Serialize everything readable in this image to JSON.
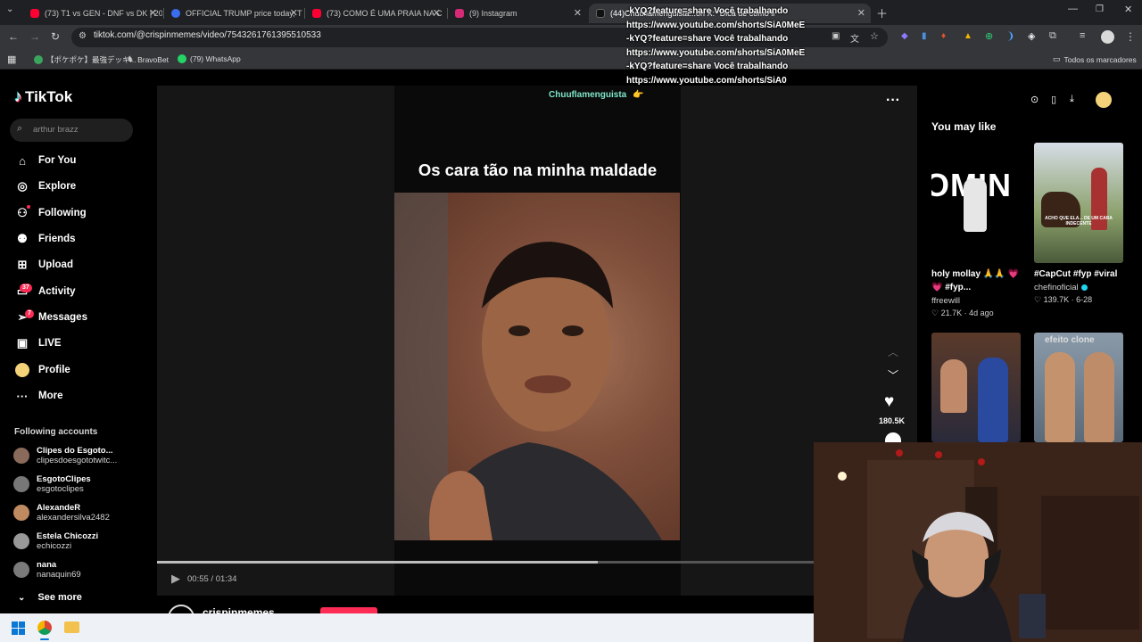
{
  "browser": {
    "tabs": [
      {
        "title": "(73) T1 vs GEN - DNF vs DK | 20",
        "favicon_color": "#ff0033",
        "active": false
      },
      {
        "title": "OFFICIAL TRUMP price today, T",
        "favicon_color": "#3a6df0",
        "active": false
      },
      {
        "title": "(73) COMO É UMA PRAIA NA C",
        "favicon_color": "#ff0033",
        "active": false
      },
      {
        "title": "(9) Instagram",
        "favicon_color": "#d62976",
        "active": false
      },
      {
        "title": "(44)Chuuflamenguista...on X: \"Dica de como li",
        "favicon_color": "#111111",
        "active": true
      }
    ],
    "url": "tiktok.com/@crispinmemes/video/7543261761395510533",
    "bookmarks": [
      {
        "label": "【ポケポケ】最強デッキ...",
        "icon": "globe-icon"
      },
      {
        "label": "BravoBet",
        "icon": "bravobet-icon"
      },
      {
        "label": "(79) WhatsApp",
        "icon": "whatsapp-icon"
      }
    ],
    "all_bookmarks_label": "Todos os marcadores"
  },
  "overlay_lines": [
    "-kYQ?feature=share Você trabalhando",
    "https://www.youtube.com/shorts/SiA0MeE",
    "-kYQ?feature=share Você trabalhando",
    "https://www.youtube.com/shorts/SiA0MeE",
    "-kYQ?feature=share Você trabalhando",
    "https://www.youtube.com/shorts/SiA0"
  ],
  "tiktok": {
    "logo": "TikTok",
    "search_placeholder": "arthur brazz",
    "nav": [
      {
        "label": "For You",
        "icon": "home-icon",
        "badge": ""
      },
      {
        "label": "Explore",
        "icon": "compass-icon",
        "badge": ""
      },
      {
        "label": "Following",
        "icon": "following-icon",
        "badge": ""
      },
      {
        "label": "Friends",
        "icon": "friends-icon",
        "badge": ""
      },
      {
        "label": "Upload",
        "icon": "upload-icon",
        "badge": ""
      },
      {
        "label": "Activity",
        "icon": "activity-icon",
        "badge": "37"
      },
      {
        "label": "Messages",
        "icon": "messages-icon",
        "badge": "7"
      },
      {
        "label": "LIVE",
        "icon": "live-icon",
        "badge": ""
      },
      {
        "label": "Profile",
        "icon": "profile-icon",
        "badge": ""
      },
      {
        "label": "More",
        "icon": "more-icon",
        "badge": ""
      }
    ],
    "following_accounts_title": "Following accounts",
    "following_accounts": [
      {
        "name": "Clipes do Esgoto...",
        "handle": "clipesdoesgototwitc...",
        "avatar_color": "#8a6a5a"
      },
      {
        "name": "EsgotoClipes",
        "handle": "esgotoclipes",
        "avatar_color": "#777777"
      },
      {
        "name": "AlexandeR",
        "handle": "alexandersilva2482",
        "avatar_color": "#c08a60"
      },
      {
        "name": "Estela Chicozzi",
        "handle": "echicozzi",
        "avatar_color": "#999999"
      },
      {
        "name": "nana",
        "handle": "nanaquin69",
        "avatar_color": "#7a7a7a"
      }
    ],
    "see_more": "See more",
    "video": {
      "watermark": "Chuuflamenguista",
      "caption": "Os cara tão na minha maldade",
      "current_time": "00:55",
      "duration": "01:34",
      "time_display": "00:55 / 01:34",
      "progress": 0.67,
      "likes": "180.5K",
      "author": "crispinmemes"
    },
    "you_may_like_title": "You may like",
    "recommendations": [
      {
        "title1": "holy mollay 🙏🙏 💗",
        "title2": "💗 #fyp...",
        "author": "ffreewill",
        "likes": "21.7K",
        "date": "4d ago",
        "thumb_text": "OMIN"
      },
      {
        "title1": "#CapCut #fyp #viral",
        "title2": "",
        "author": "chefinoficial",
        "likes": "139.7K",
        "date": "6-28",
        "thumb_text": "ACHO QUE ELA... DE UM CARA INDECENTE"
      },
      {
        "thumb_text": ""
      },
      {
        "thumb_text": "efeito clone"
      }
    ]
  },
  "colors": {
    "tiktok_pink": "#fe2c55",
    "tiktok_cyan": "#25f4ee",
    "watermark": "#7fe6c9"
  }
}
